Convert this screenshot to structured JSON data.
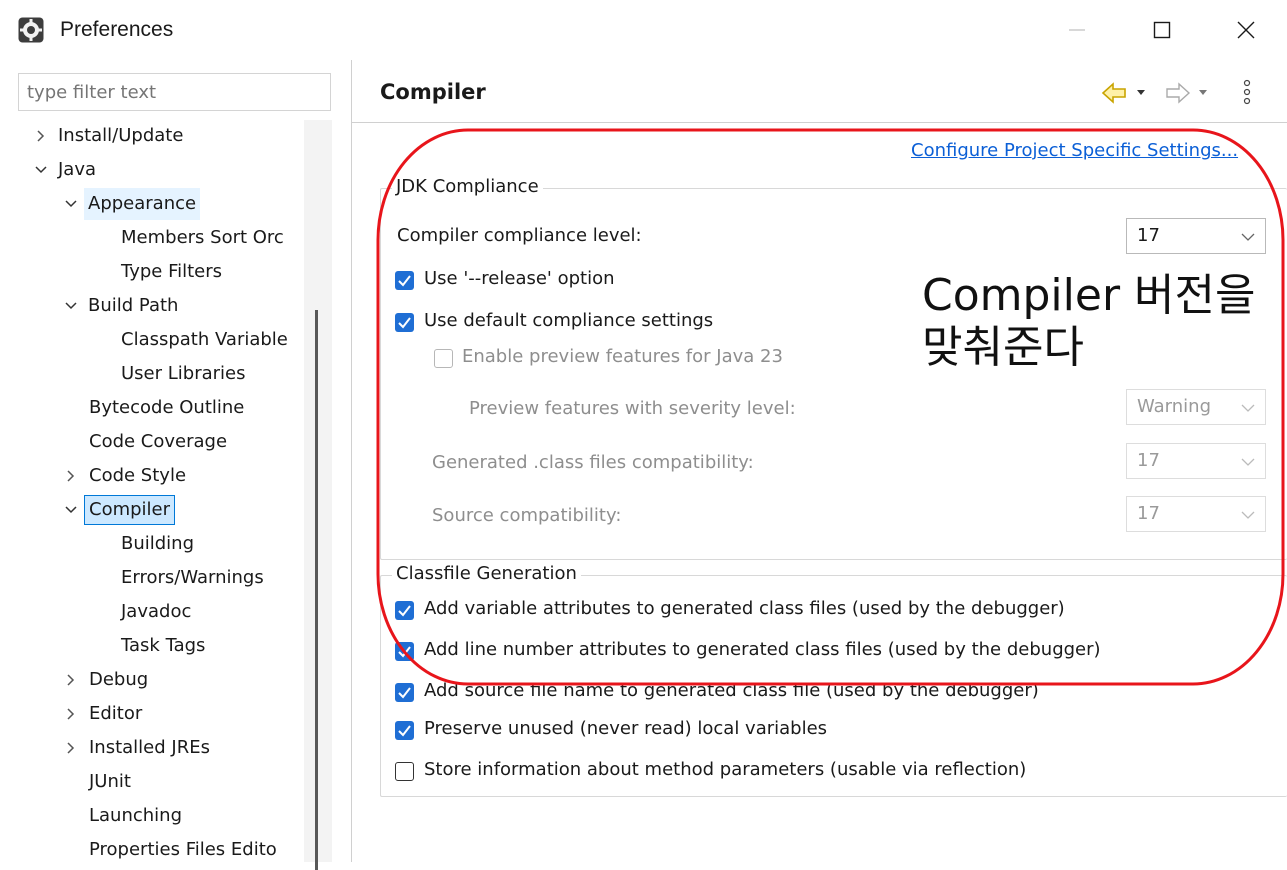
{
  "window": {
    "title": "Preferences"
  },
  "filter": {
    "placeholder": "type filter text"
  },
  "tree": [
    {
      "label": "Install/Update",
      "state": "collapsed",
      "level": 0
    },
    {
      "label": "Java",
      "state": "expanded",
      "level": 0
    },
    {
      "label": "Appearance",
      "state": "expanded",
      "level": 1
    },
    {
      "label": "Members Sort Orc",
      "state": "leaf",
      "level": 2
    },
    {
      "label": "Type Filters",
      "state": "leaf",
      "level": 2
    },
    {
      "label": "Build Path",
      "state": "expanded",
      "level": 1
    },
    {
      "label": "Classpath Variable",
      "state": "leaf",
      "level": 2
    },
    {
      "label": "User Libraries",
      "state": "leaf",
      "level": 2
    },
    {
      "label": "Bytecode Outline",
      "state": "leaf",
      "level": 1
    },
    {
      "label": "Code Coverage",
      "state": "leaf",
      "level": 1
    },
    {
      "label": "Code Style",
      "state": "collapsed",
      "level": 1
    },
    {
      "label": "Compiler",
      "state": "expanded",
      "level": 1,
      "selected": true
    },
    {
      "label": "Building",
      "state": "leaf",
      "level": 2
    },
    {
      "label": "Errors/Warnings",
      "state": "leaf",
      "level": 2
    },
    {
      "label": "Javadoc",
      "state": "leaf",
      "level": 2
    },
    {
      "label": "Task Tags",
      "state": "leaf",
      "level": 2
    },
    {
      "label": "Debug",
      "state": "collapsed",
      "level": 1
    },
    {
      "label": "Editor",
      "state": "collapsed",
      "level": 1
    },
    {
      "label": "Installed JREs",
      "state": "collapsed",
      "level": 1
    },
    {
      "label": "JUnit",
      "state": "leaf",
      "level": 1
    },
    {
      "label": "Launching",
      "state": "leaf",
      "level": 1
    },
    {
      "label": "Properties Files Edito",
      "state": "leaf",
      "level": 1
    }
  ],
  "page": {
    "title": "Compiler",
    "configure_link": "Configure Project Specific Settings..."
  },
  "jdk": {
    "legend": "JDK Compliance",
    "compliance_label": "Compiler compliance level:",
    "compliance_value": "17",
    "release_label": "Use '--release' option",
    "release_checked": true,
    "default_label": "Use default compliance settings",
    "default_checked": true,
    "preview_label": "Enable preview features for Java 23",
    "preview_checked": false,
    "severity_label": "Preview features with severity level:",
    "severity_value": "Warning",
    "generated_label": "Generated .class files compatibility:",
    "generated_value": "17",
    "source_label": "Source compatibility:",
    "source_value": "17"
  },
  "classfile": {
    "legend": "Classfile Generation",
    "options": [
      {
        "label": "Add variable attributes to generated class files (used by the debugger)",
        "checked": true
      },
      {
        "label": "Add line number attributes to generated class files (used by the debugger)",
        "checked": true
      },
      {
        "label": "Add source file name to generated class file (used by the debugger)",
        "checked": true
      },
      {
        "label": "Preserve unused (never read) local variables",
        "checked": true
      },
      {
        "label": "Store information about method parameters (usable via reflection)",
        "checked": false
      }
    ]
  },
  "annotation": {
    "line1": "Compiler 버전을",
    "line2": "맞춰준다",
    "color": "#e8151b"
  },
  "colors": {
    "accent": "#1f6ed4",
    "link": "#0b5fd6",
    "selection": "#cce8ff"
  }
}
